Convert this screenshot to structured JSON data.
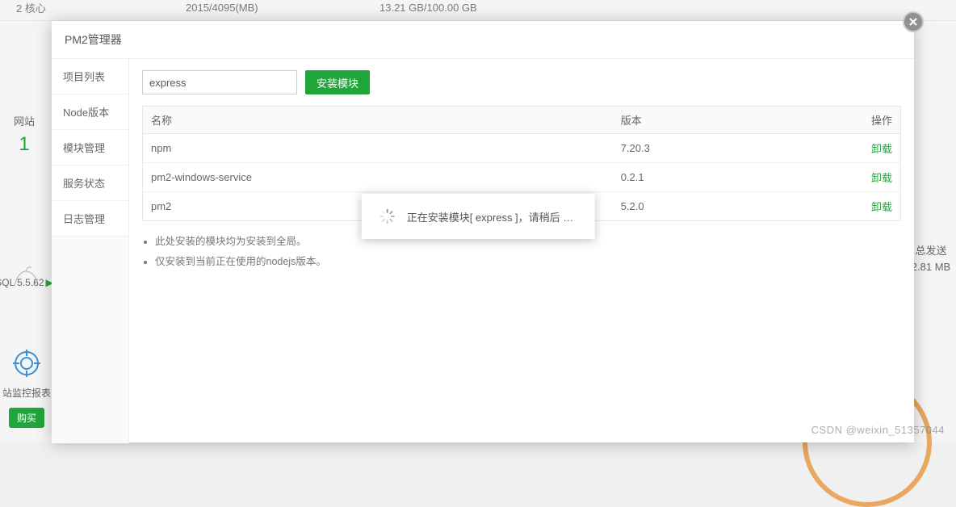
{
  "bg": {
    "cpu_cores": "2 核心",
    "memory": "2015/4095(MB)",
    "disk": "13.21 GB/100.00 GB",
    "nav_website": "网站",
    "nav_count": "1",
    "mysql_label": "SQL 5.5.62",
    "monitor_label": "站监控报表",
    "buy_label": "购买",
    "right_label": "总发送",
    "right_value": "2.81 MB"
  },
  "modal": {
    "title": "PM2管理器"
  },
  "sidebar": {
    "items": [
      {
        "label": "项目列表"
      },
      {
        "label": "Node版本"
      },
      {
        "label": "模块管理"
      },
      {
        "label": "服务状态"
      },
      {
        "label": "日志管理"
      }
    ]
  },
  "toolbar": {
    "search_value": "express",
    "install_label": "安装模块"
  },
  "table": {
    "headers": {
      "name": "名称",
      "version": "版本",
      "op": "操作"
    },
    "rows": [
      {
        "name": "npm",
        "version": "7.20.3",
        "op": "卸载"
      },
      {
        "name": "pm2-windows-service",
        "version": "0.2.1",
        "op": "卸载"
      },
      {
        "name": "pm2",
        "version": "5.2.0",
        "op": "卸载"
      }
    ]
  },
  "notes": {
    "items": [
      "此处安装的模块均为安装到全局。",
      "仅安装到当前正在使用的nodejs版本。"
    ]
  },
  "toast": {
    "text": "正在安装模块[ express ]，请稍后 …"
  },
  "watermark": "CSDN @weixin_51357044"
}
